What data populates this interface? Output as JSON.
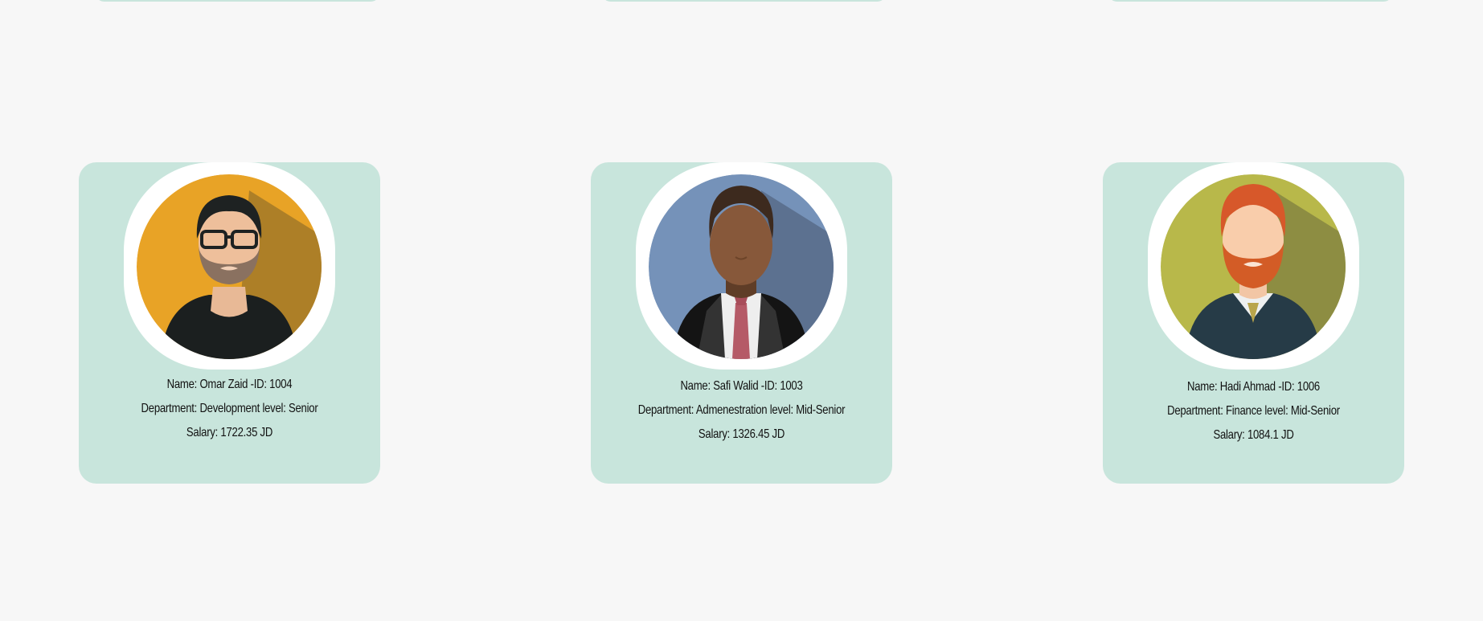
{
  "employees": [
    {
      "name_line": "Name: Omar Zaid -ID: 1004",
      "dept_line": "Department: Development level: Senior",
      "salary_line": "Salary: 1722.35 JD",
      "avatar_icon": "man-glasses-beard-avatar-icon",
      "avatar_bg": "#e8a326"
    },
    {
      "name_line": "Name: Safi Walid -ID: 1003",
      "dept_line": "Department: Admenestration level: Mid-Senior",
      "salary_line": "Salary: 1326.45 JD",
      "avatar_icon": "man-suit-tie-avatar-icon",
      "avatar_bg": "#7592b9"
    },
    {
      "name_line": "Name: Hadi Ahmad -ID: 1006",
      "dept_line": "Department: Finance level: Mid-Senior",
      "salary_line": "Salary: 1084.1 JD",
      "avatar_icon": "man-red-beard-avatar-icon",
      "avatar_bg": "#b8b84a"
    }
  ],
  "colors": {
    "page_bg": "#f7f7f7",
    "card_bg": "#c8e5dc"
  }
}
